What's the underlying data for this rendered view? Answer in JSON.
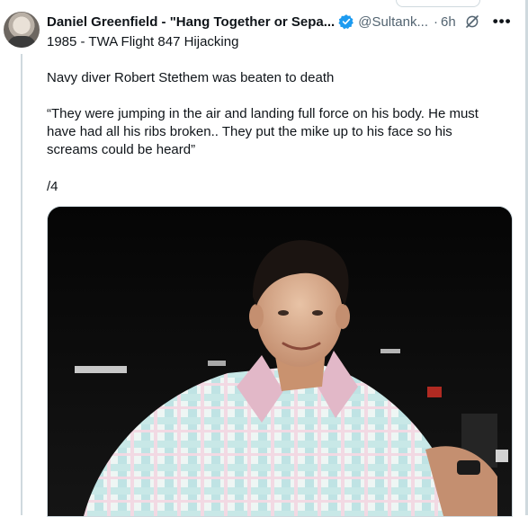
{
  "tweet": {
    "author_name": "Daniel Greenfield - \"Hang Together or Sepa...",
    "handle": "@Sultank...",
    "separator": "·",
    "time": "6h",
    "lines": [
      "1985 - TWA Flight 847 Hijacking",
      "Navy diver Robert Stethem was beaten to death",
      "“They were jumping in the air and landing full force on his body. He must have had all his ribs broken.. They put the mike up to his face so his screams could be heard”",
      "/4"
    ]
  },
  "icons": {
    "verified": "verified-badge-icon",
    "grok": "grok-icon",
    "more": "more-options-icon"
  },
  "colors": {
    "accent": "#1d9bf0",
    "secondary_text": "#536471",
    "primary_text": "#0f1419"
  }
}
